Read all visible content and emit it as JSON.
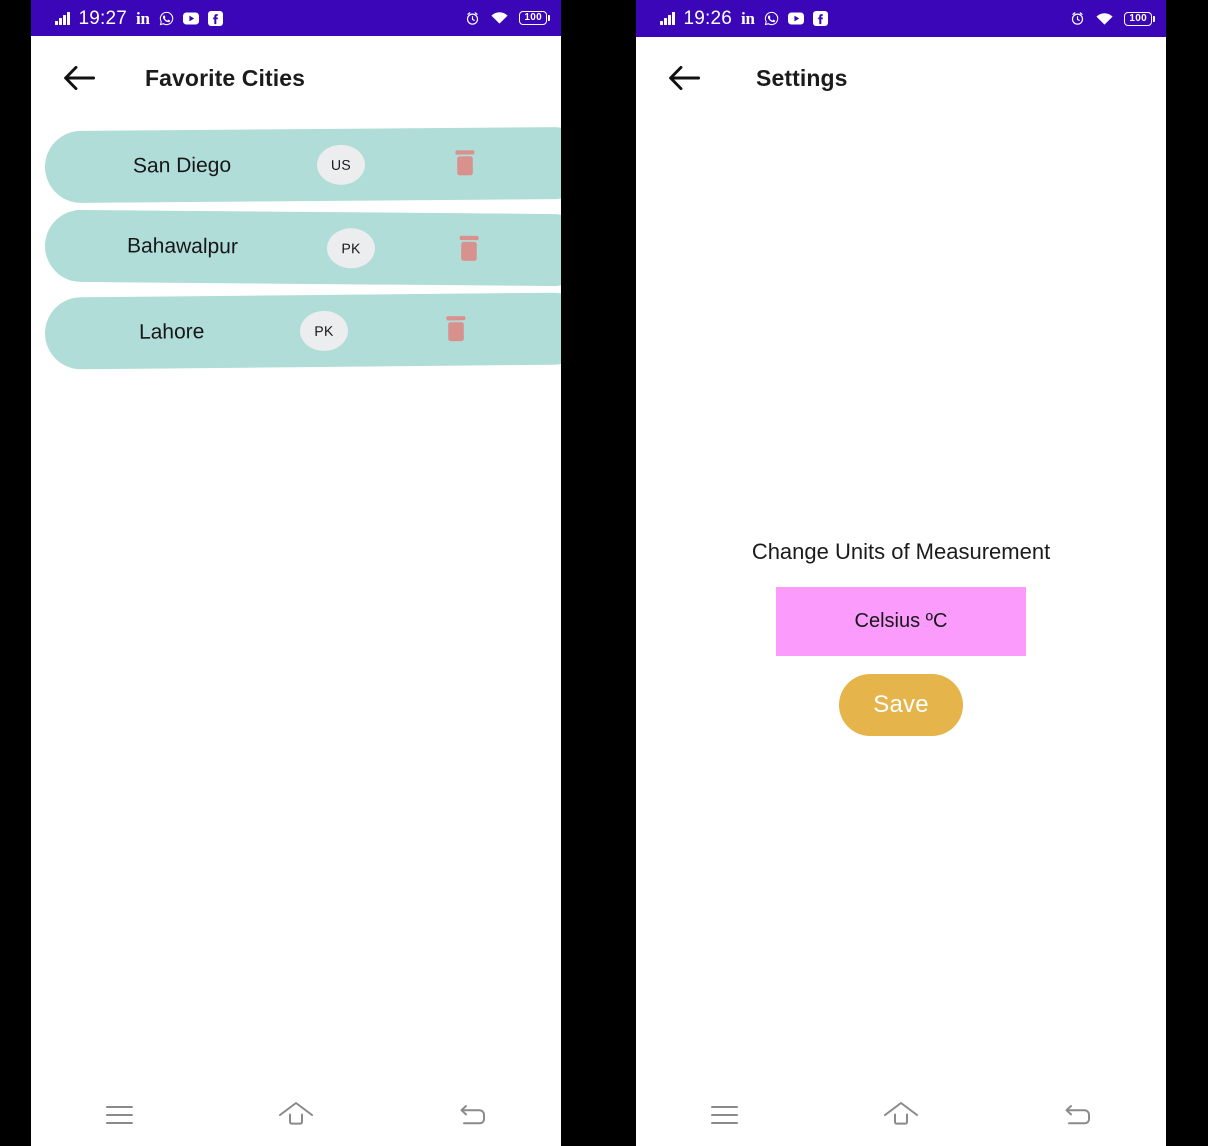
{
  "theme": {
    "status_bar_color": "#3a06b8",
    "card_color": "#b0ddd8",
    "badge_color": "#ecedef",
    "trash_color": "#d9918e",
    "select_color": "#fb9bfb",
    "save_button_color": "#e5b44a",
    "text_color": "#17171a",
    "nav_icon_color": "#8a8a8a"
  },
  "left_phone": {
    "status_bar": {
      "time": "19:27",
      "signal_icon": "signal-bars-icon",
      "app_icons": [
        "linkedin-icon",
        "whatsapp-icon",
        "youtube-icon",
        "facebook-icon"
      ],
      "linkedin_label": "in",
      "alarm_icon": "alarm-clock-icon",
      "wifi_icon": "wifi-icon",
      "battery_level": "100"
    },
    "appbar": {
      "back_icon": "back-arrow-icon",
      "title": "Favorite Cities"
    },
    "cities": [
      {
        "name": "San Diego",
        "country": "US",
        "delete_icon": "trash-icon"
      },
      {
        "name": "Bahawalpur",
        "country": "PK",
        "delete_icon": "trash-icon"
      },
      {
        "name": "Lahore",
        "country": "PK",
        "delete_icon": "trash-icon"
      }
    ],
    "navbar": {
      "recents_icon": "recents-menu-icon",
      "home_icon": "home-icon",
      "back_icon": "back-nav-icon"
    }
  },
  "right_phone": {
    "status_bar": {
      "time": "19:26",
      "signal_icon": "signal-bars-icon",
      "app_icons": [
        "linkedin-icon",
        "whatsapp-icon",
        "youtube-icon",
        "facebook-icon"
      ],
      "linkedin_label": "in",
      "alarm_icon": "alarm-clock-icon",
      "wifi_icon": "wifi-icon",
      "battery_level": "100"
    },
    "appbar": {
      "back_icon": "back-arrow-icon",
      "title": "Settings"
    },
    "settings": {
      "section_label": "Change Units of Measurement",
      "unit_selected": "Celsius ºC",
      "save_label": "Save"
    },
    "navbar": {
      "recents_icon": "recents-menu-icon",
      "home_icon": "home-icon",
      "back_icon": "back-nav-icon"
    }
  }
}
